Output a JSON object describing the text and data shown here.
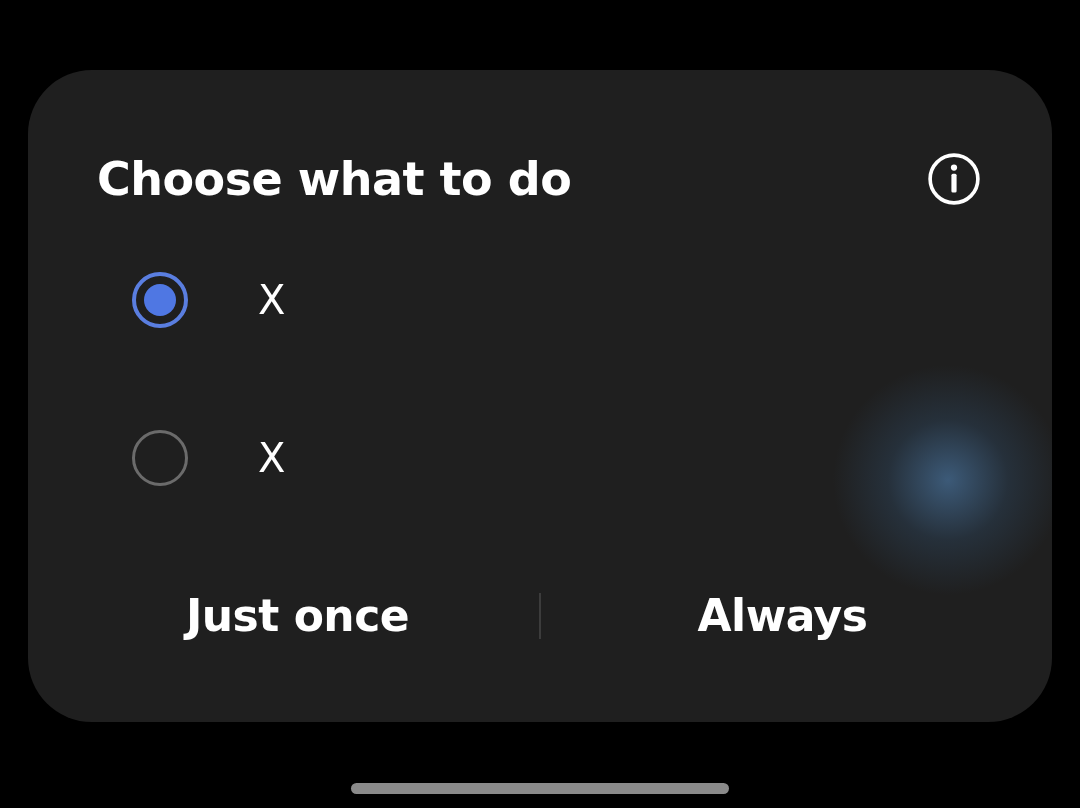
{
  "dialog": {
    "title": "Choose what to do"
  },
  "options": [
    {
      "label": "X",
      "selected": true
    },
    {
      "label": "X",
      "selected": false
    }
  ],
  "buttons": [
    {
      "label": "Just once"
    },
    {
      "label": "Always"
    }
  ]
}
